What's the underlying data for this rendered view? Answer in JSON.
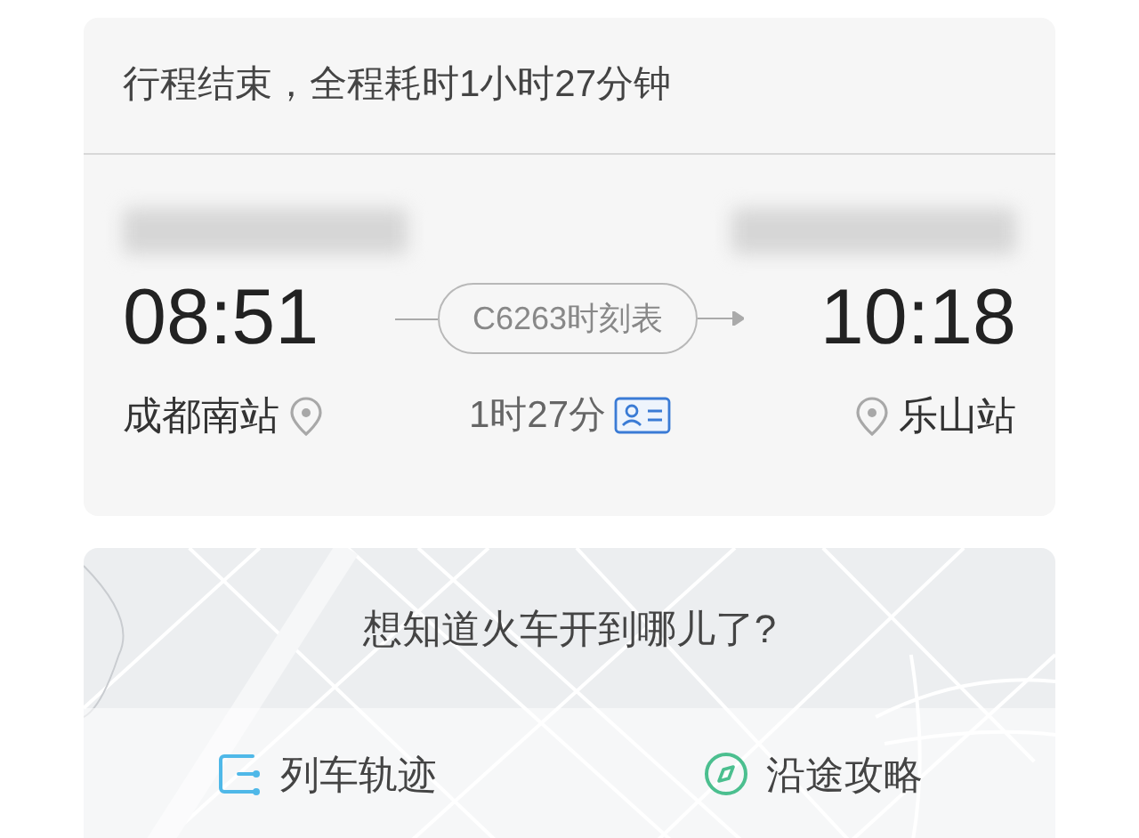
{
  "trip": {
    "summary": "行程结束，全程耗时1小时27分钟",
    "departure": {
      "time": "08:51",
      "station": "成都南站"
    },
    "arrival": {
      "time": "10:18",
      "station": "乐山站"
    },
    "timetable_button": "C6263时刻表",
    "duration": "1时27分"
  },
  "map_card": {
    "kind": "picture",
    "prompt": "想知道火车开到哪儿了?",
    "actions": [
      {
        "kind": "track",
        "label": "列车轨迹"
      },
      {
        "kind": "guide",
        "label": "沿途攻略"
      }
    ]
  }
}
